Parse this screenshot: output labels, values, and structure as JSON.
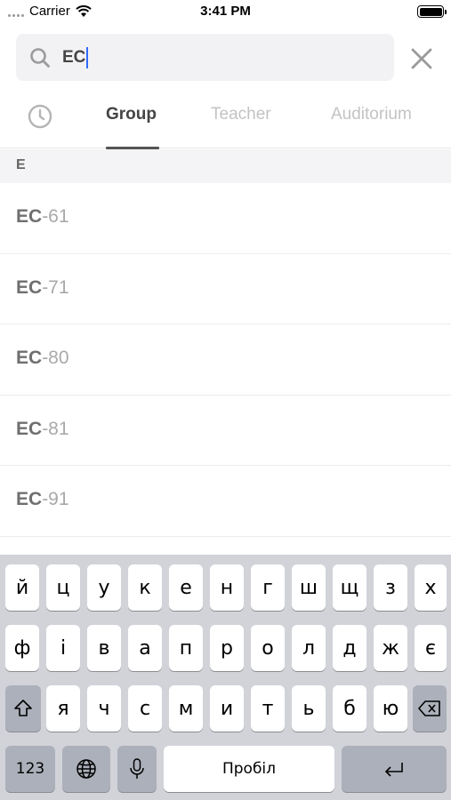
{
  "status_bar": {
    "carrier": "Carrier",
    "time": "3:41 PM"
  },
  "search": {
    "value": "EC"
  },
  "tabs": [
    {
      "label": "Group",
      "active": true
    },
    {
      "label": "Teacher",
      "active": false
    },
    {
      "label": "Auditorium",
      "active": false
    }
  ],
  "section": {
    "letter": "E"
  },
  "results": [
    {
      "prefix": "EC",
      "suffix": "-61"
    },
    {
      "prefix": "EC",
      "suffix": "-71"
    },
    {
      "prefix": "EC",
      "suffix": "-80"
    },
    {
      "prefix": "EC",
      "suffix": "-81"
    },
    {
      "prefix": "EC",
      "suffix": "-91"
    }
  ],
  "keyboard": {
    "row1": [
      "й",
      "ц",
      "у",
      "к",
      "е",
      "н",
      "г",
      "ш",
      "щ",
      "з",
      "х"
    ],
    "row2": [
      "ф",
      "і",
      "в",
      "а",
      "п",
      "р",
      "о",
      "л",
      "д",
      "ж",
      "є"
    ],
    "row3": [
      "я",
      "ч",
      "с",
      "м",
      "и",
      "т",
      "ь",
      "б",
      "ю"
    ],
    "numbers_label": "123",
    "space_label": "Пробіл"
  },
  "colors": {
    "accent_caret": "#2f6bff",
    "keyboard_bg": "#d1d3d9"
  }
}
